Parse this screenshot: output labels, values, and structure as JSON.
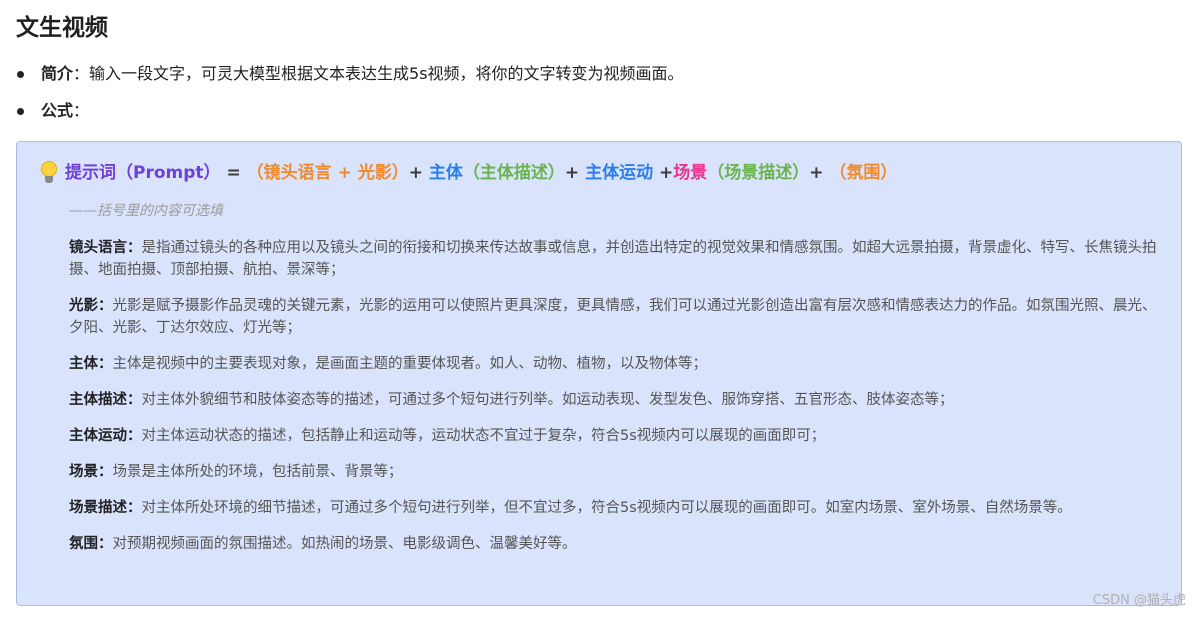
{
  "title": "文生视频",
  "bullets": [
    {
      "label": "简介",
      "sep": "：",
      "text": "输入一段文字，可灵大模型根据文本表达生成5s视频，将你的文字转变为视频画面。"
    },
    {
      "label": "公式",
      "sep": "：",
      "text": ""
    }
  ],
  "formula": {
    "icon": "lightbulb-icon",
    "prompt": "提示词（Prompt）",
    "eq": " = ",
    "lens": "（镜头语言 + 光影）",
    "plus1": "+ ",
    "subject": "主体",
    "subject_desc": "（主体描述）",
    "plus2": "+ ",
    "motion": "主体运动",
    "plus3": " +",
    "scene": "场景",
    "scene_desc": "（场景描述）",
    "plus4": "+ ",
    "atmosphere": "（氛围）"
  },
  "note": "——括号里的内容可选填",
  "definitions": [
    {
      "term": "镜头语言：",
      "body": "是指通过镜头的各种应用以及镜头之间的衔接和切换来传达故事或信息，并创造出特定的视觉效果和情感氛围。如超大远景拍摄，背景虚化、特写、长焦镜头拍摄、地面拍摄、顶部拍摄、航拍、景深等；"
    },
    {
      "term": "光影：",
      "body": "光影是赋予摄影作品灵魂的关键元素，光影的运用可以使照片更具深度，更具情感，我们可以通过光影创造出富有层次感和情感表达力的作品。如氛围光照、晨光、夕阳、光影、丁达尔效应、灯光等；"
    },
    {
      "term": "主体：",
      "body": "主体是视频中的主要表现对象，是画面主题的重要体现者。如人、动物、植物，以及物体等；"
    },
    {
      "term": "主体描述：",
      "body": "对主体外貌细节和肢体姿态等的描述，可通过多个短句进行列举。如运动表现、发型发色、服饰穿搭、五官形态、肢体姿态等；"
    },
    {
      "term": "主体运动：",
      "body": "对主体运动状态的描述，包括静止和运动等，运动状态不宜过于复杂，符合5s视频内可以展现的画面即可；"
    },
    {
      "term": "场景：",
      "body": "场景是主体所处的环境，包括前景、背景等；"
    },
    {
      "term": "场景描述：",
      "body": "对主体所处环境的细节描述，可通过多个短句进行列举，但不宜过多，符合5s视频内可以展现的画面即可。如室内场景、室外场景、自然场景等。"
    },
    {
      "term": "氛围：",
      "body": "对预期视频画面的氛围描述。如热闹的场景、电影级调色、温馨美好等。"
    }
  ],
  "watermark": "CSDN @猫头虎",
  "colors": {
    "callout_bg": "#d9e4fc",
    "prompt": "#6f3fd8",
    "orange": "#f08a2c",
    "blue": "#2b7de9",
    "green": "#6bb34f",
    "pink": "#e8348c"
  }
}
